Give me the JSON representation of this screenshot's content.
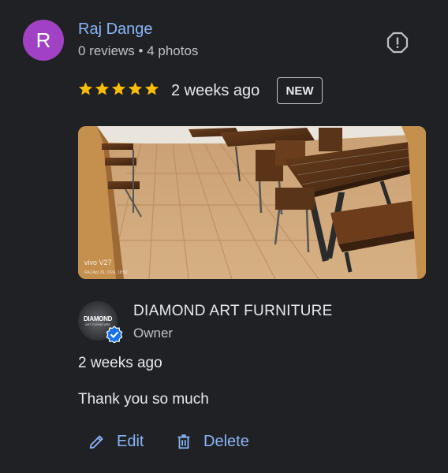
{
  "review": {
    "avatar_letter": "R",
    "avatar_color": "#a142c4",
    "reviewer_name": "Raj Dange",
    "reviewer_meta": "0 reviews • 4 photos",
    "rating": 5,
    "time_ago": "2 weeks ago",
    "badge": "NEW",
    "report_icon": "report-icon",
    "photo": {
      "watermark_model": "vivo V27",
      "watermark_date": "RAJ  Apr 26, 2024, 18:52"
    }
  },
  "reply": {
    "owner_logo_text": "DIAMOND",
    "owner_logo_sub": "ART FURNITURE",
    "owner_name": "DIAMOND ART FURNITURE",
    "owner_role": "Owner",
    "time_ago": "2 weeks ago",
    "text": "Thank you so much"
  },
  "actions": {
    "edit_label": "Edit",
    "delete_label": "Delete",
    "edit_icon": "pencil-icon",
    "delete_icon": "trash-icon"
  },
  "colors": {
    "background": "#202124",
    "link": "#8ab4f8",
    "star": "#fbbc04",
    "verified": "#1a73e8"
  }
}
